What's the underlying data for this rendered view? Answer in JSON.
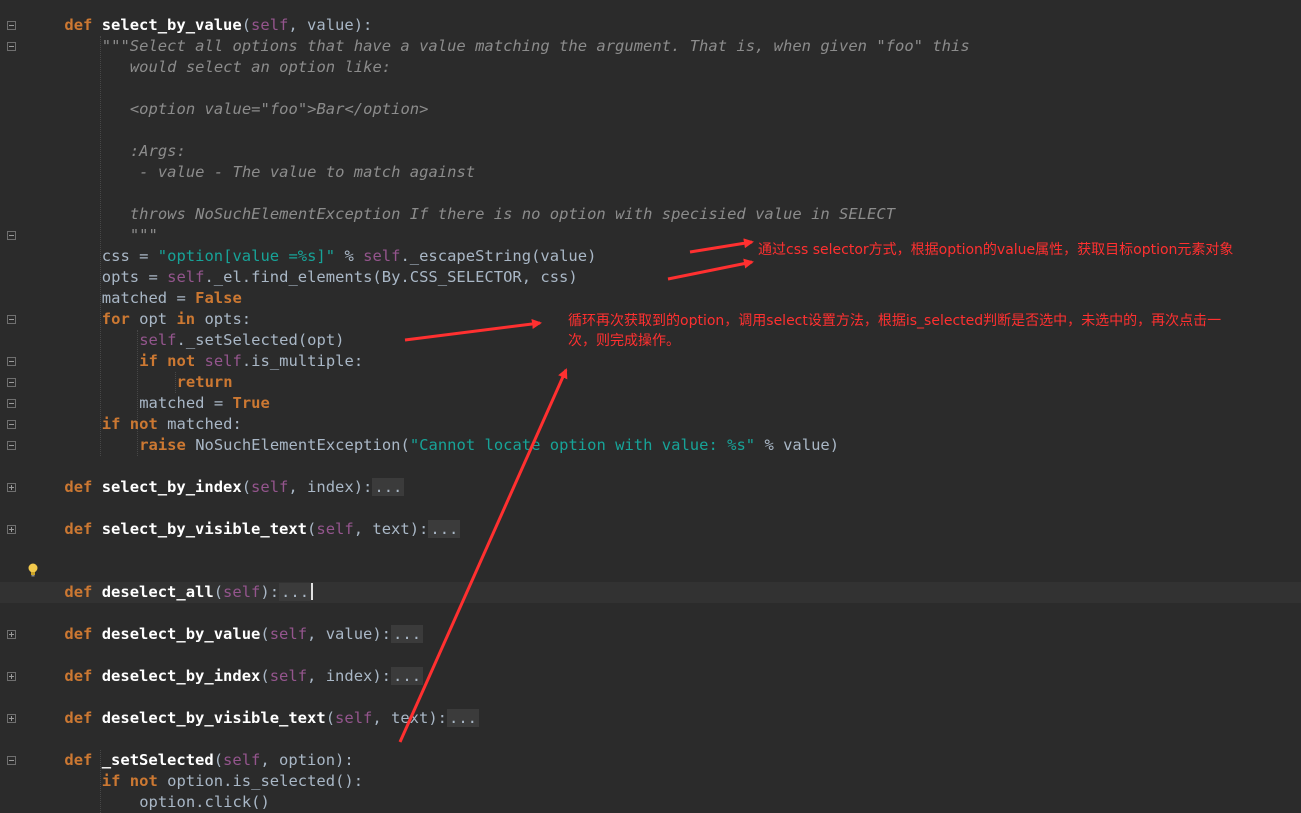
{
  "editor": {
    "language": "python",
    "current_line_index": 27,
    "accent": "#cc7832",
    "lines": [
      {
        "indent": 4,
        "segments": [
          {
            "t": "def ",
            "c": "kw"
          },
          {
            "t": "select_by_value",
            "c": "fnw"
          },
          {
            "t": "(",
            "c": ""
          },
          {
            "t": "self",
            "c": "self"
          },
          {
            "t": ", value):",
            "c": ""
          }
        ],
        "fold": "minus"
      },
      {
        "indent": 8,
        "segments": [
          {
            "t": "\"\"\"Select all options that have a value matching the argument. That is, when given \"foo\" this",
            "c": "doc2"
          }
        ],
        "fold": "minus"
      },
      {
        "indent": 11,
        "segments": [
          {
            "t": "would select an option like:",
            "c": "doc2"
          }
        ]
      },
      {
        "indent": 0,
        "segments": []
      },
      {
        "indent": 11,
        "segments": [
          {
            "t": "<option value=\"foo\">Bar</option>",
            "c": "doc2"
          }
        ]
      },
      {
        "indent": 0,
        "segments": []
      },
      {
        "indent": 11,
        "segments": [
          {
            "t": ":Args:",
            "c": "doc2"
          }
        ]
      },
      {
        "indent": 11,
        "segments": [
          {
            "t": " - value - The value to match against",
            "c": "doc2"
          }
        ]
      },
      {
        "indent": 0,
        "segments": []
      },
      {
        "indent": 11,
        "segments": [
          {
            "t": "throws NoSuchElementException If there is no option with specisied value in SELECT",
            "c": "doc2"
          }
        ]
      },
      {
        "indent": 11,
        "segments": [
          {
            "t": "\"\"\"",
            "c": "doc2"
          }
        ],
        "fold": "end"
      },
      {
        "indent": 8,
        "segments": [
          {
            "t": "css = ",
            "c": ""
          },
          {
            "t": "\"option[value =%s]\"",
            "c": "strc"
          },
          {
            "t": " % ",
            "c": ""
          },
          {
            "t": "self",
            "c": "self"
          },
          {
            "t": "._escapeString(value)",
            "c": ""
          }
        ]
      },
      {
        "indent": 8,
        "segments": [
          {
            "t": "opts = ",
            "c": ""
          },
          {
            "t": "self",
            "c": "self"
          },
          {
            "t": "._el.find_elements(By.CSS_SELECTOR, css)",
            "c": ""
          }
        ]
      },
      {
        "indent": 8,
        "segments": [
          {
            "t": "matched = ",
            "c": ""
          },
          {
            "t": "False",
            "c": "kw"
          }
        ]
      },
      {
        "indent": 8,
        "segments": [
          {
            "t": "for ",
            "c": "kw"
          },
          {
            "t": "opt ",
            "c": ""
          },
          {
            "t": "in ",
            "c": "kw"
          },
          {
            "t": "opts:",
            "c": ""
          }
        ],
        "fold": "minus"
      },
      {
        "indent": 12,
        "segments": [
          {
            "t": "self",
            "c": "self"
          },
          {
            "t": "._setSelected(opt)",
            "c": ""
          }
        ]
      },
      {
        "indent": 12,
        "segments": [
          {
            "t": "if not ",
            "c": "kw"
          },
          {
            "t": "self",
            "c": "self"
          },
          {
            "t": ".is_multiple:",
            "c": ""
          }
        ],
        "fold": "minus"
      },
      {
        "indent": 16,
        "segments": [
          {
            "t": "return",
            "c": "kw"
          }
        ],
        "fold": "end"
      },
      {
        "indent": 12,
        "segments": [
          {
            "t": "matched = ",
            "c": ""
          },
          {
            "t": "True",
            "c": "kw"
          }
        ],
        "fold": "end"
      },
      {
        "indent": 8,
        "segments": [
          {
            "t": "if not ",
            "c": "kw"
          },
          {
            "t": "matched:",
            "c": ""
          }
        ],
        "fold": "minus"
      },
      {
        "indent": 12,
        "segments": [
          {
            "t": "raise ",
            "c": "kw"
          },
          {
            "t": "NoSuchElementException(",
            "c": ""
          },
          {
            "t": "\"Cannot locate option with value: %s\"",
            "c": "strc"
          },
          {
            "t": " % value)",
            "c": ""
          }
        ],
        "fold": "end"
      },
      {
        "indent": 0,
        "segments": []
      },
      {
        "indent": 4,
        "segments": [
          {
            "t": "def ",
            "c": "kw"
          },
          {
            "t": "select_by_index",
            "c": "fnw"
          },
          {
            "t": "(",
            "c": ""
          },
          {
            "t": "self",
            "c": "self"
          },
          {
            "t": ", index):",
            "c": ""
          },
          {
            "t": "...",
            "c": "fold"
          }
        ],
        "fold": "plus"
      },
      {
        "indent": 0,
        "segments": []
      },
      {
        "indent": 4,
        "segments": [
          {
            "t": "def ",
            "c": "kw"
          },
          {
            "t": "select_by_visible_text",
            "c": "fnw"
          },
          {
            "t": "(",
            "c": ""
          },
          {
            "t": "self",
            "c": "self"
          },
          {
            "t": ", text):",
            "c": ""
          },
          {
            "t": "...",
            "c": "fold"
          }
        ],
        "fold": "plus"
      },
      {
        "indent": 0,
        "segments": []
      },
      {
        "indent": 0,
        "segments": []
      },
      {
        "indent": 4,
        "segments": [
          {
            "t": "def ",
            "c": "kw"
          },
          {
            "t": "deselect_all",
            "c": "fnw"
          },
          {
            "t": "(",
            "c": ""
          },
          {
            "t": "self",
            "c": "self"
          },
          {
            "t": "):",
            "c": ""
          },
          {
            "t": "...",
            "c": "fold"
          },
          {
            "t": "",
            "c": "caret"
          }
        ],
        "fold": "plus",
        "bulb": true
      },
      {
        "indent": 0,
        "segments": []
      },
      {
        "indent": 4,
        "segments": [
          {
            "t": "def ",
            "c": "kw"
          },
          {
            "t": "deselect_by_value",
            "c": "fnw"
          },
          {
            "t": "(",
            "c": ""
          },
          {
            "t": "self",
            "c": "self"
          },
          {
            "t": ", value):",
            "c": ""
          },
          {
            "t": "...",
            "c": "fold"
          }
        ],
        "fold": "plus"
      },
      {
        "indent": 0,
        "segments": []
      },
      {
        "indent": 4,
        "segments": [
          {
            "t": "def ",
            "c": "kw"
          },
          {
            "t": "deselect_by_index",
            "c": "fnw"
          },
          {
            "t": "(",
            "c": ""
          },
          {
            "t": "self",
            "c": "self"
          },
          {
            "t": ", index):",
            "c": ""
          },
          {
            "t": "...",
            "c": "fold"
          }
        ],
        "fold": "plus"
      },
      {
        "indent": 0,
        "segments": []
      },
      {
        "indent": 4,
        "segments": [
          {
            "t": "def ",
            "c": "kw"
          },
          {
            "t": "deselect_by_visible_text",
            "c": "fnw"
          },
          {
            "t": "(",
            "c": ""
          },
          {
            "t": "self",
            "c": "self"
          },
          {
            "t": ", text):",
            "c": ""
          },
          {
            "t": "...",
            "c": "fold"
          }
        ],
        "fold": "plus"
      },
      {
        "indent": 0,
        "segments": []
      },
      {
        "indent": 4,
        "segments": [
          {
            "t": "def ",
            "c": "kw"
          },
          {
            "t": "_setSelected",
            "c": "fnw"
          },
          {
            "t": "(",
            "c": ""
          },
          {
            "t": "self",
            "c": "self"
          },
          {
            "t": ", option):",
            "c": ""
          }
        ],
        "fold": "minus"
      },
      {
        "indent": 8,
        "segments": [
          {
            "t": "if not ",
            "c": "kw"
          },
          {
            "t": "option.is_selected():",
            "c": ""
          }
        ]
      },
      {
        "indent": 12,
        "segments": [
          {
            "t": "option.click()",
            "c": ""
          }
        ]
      }
    ]
  },
  "annotations": {
    "color": "#ff3030",
    "note1": "通过css selector方式，根据option的value属性，获取目标option元素对象",
    "note2_line1": "循环再次获取到的option，调用select设置方法，根据is_selected判断是否选中，未选中的，再次点击一",
    "note2_line2": "次，则完成操作。"
  }
}
